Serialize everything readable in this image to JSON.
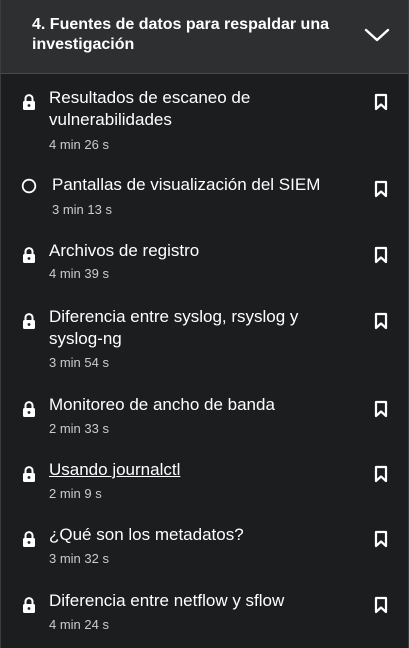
{
  "section": {
    "title": "4. Fuentes de datos para respaldar una investigación"
  },
  "lectures": [
    {
      "title": "Resultados de escaneo de vulnerabilidades",
      "duration": "4 min 26 s",
      "status_icon": "lock-icon"
    },
    {
      "title": "Pantallas de visualización del SIEM",
      "duration": "3 min 13 s",
      "status_icon": "circle-icon"
    },
    {
      "title": "Archivos de registro",
      "duration": "4 min 39 s",
      "status_icon": "lock-icon"
    },
    {
      "title": "Diferencia entre syslog, rsyslog y syslog-ng",
      "duration": "3 min 54 s",
      "status_icon": "lock-icon"
    },
    {
      "title": "Monitoreo de ancho de banda",
      "duration": "2 min 33 s",
      "status_icon": "lock-icon"
    },
    {
      "title": "Usando journalctl",
      "duration": "2 min 9 s",
      "status_icon": "lock-icon"
    },
    {
      "title": "¿Qué son los metadatos?",
      "duration": "3 min 32 s",
      "status_icon": "lock-icon"
    },
    {
      "title": "Diferencia entre netflow y sflow",
      "duration": "4 min 24 s",
      "status_icon": "lock-icon"
    }
  ],
  "colors": {
    "background": "#1b1d1f",
    "header_background": "#2d2f31",
    "text": "#ffffff",
    "secondary_text": "#c9ccd0"
  }
}
